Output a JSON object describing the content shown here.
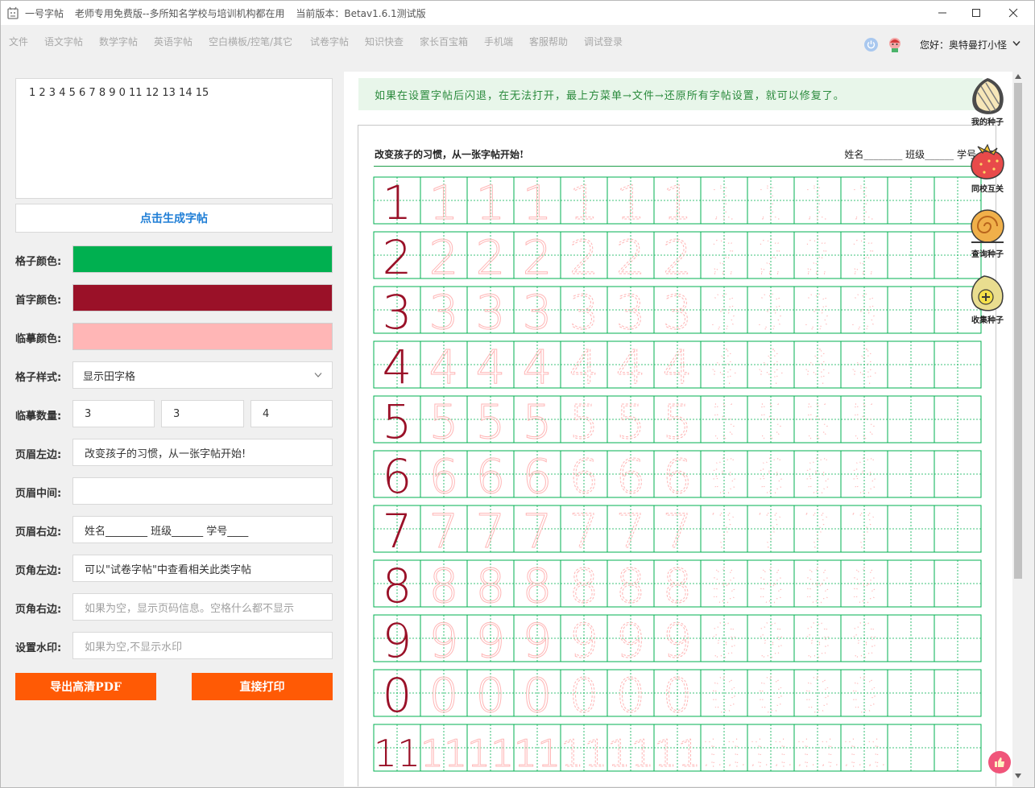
{
  "window": {
    "app_name": "一号字帖",
    "subtitle": "老师专用免费版--多所知名学校与培训机构都在用",
    "version": "当前版本：Betav1.6.1测试版"
  },
  "menu": [
    {
      "label": "文件"
    },
    {
      "label": "语文字帖"
    },
    {
      "label": "数学字帖"
    },
    {
      "label": "英语字帖"
    },
    {
      "label": "空白横板/控笔/其它"
    },
    {
      "label": "试卷字帖"
    },
    {
      "label": "知识快查"
    },
    {
      "label": "家长百宝箱"
    },
    {
      "label": "手机端"
    },
    {
      "label": "客服帮助"
    },
    {
      "label": "调试登录"
    }
  ],
  "user": {
    "greeting": "您好：奥特曼打小怪"
  },
  "form": {
    "content": "1 2 3 4 5 6 7 8 9 0 11 12 13 14 15",
    "generate_label": "点击生成字帖",
    "grid_color_label": "格子颜色:",
    "grid_color": "#00b050",
    "first_color_label": "首字颜色:",
    "first_color": "#9a1128",
    "trace_color_label": "临摹颜色:",
    "trace_color": "#ffb6b6",
    "grid_style_label": "格子样式:",
    "grid_style_value": "显示田字格",
    "trace_count_label": "临摹数量:",
    "trace_counts": [
      "3",
      "3",
      "4"
    ],
    "header_left_label": "页眉左边:",
    "header_left_value": "改变孩子的习惯，从一张字帖开始!",
    "header_middle_label": "页眉中间:",
    "header_middle_value": "",
    "header_right_label": "页眉右边:",
    "header_right_value": "姓名________ 班级______ 学号____",
    "footer_left_label": "页角左边:",
    "footer_left_value": "可以\"试卷字帖\"中查看相关此类字帖",
    "footer_right_label": "页角右边:",
    "footer_right_placeholder": "如果为空，显示页码信息。空格什么都不显示",
    "watermark_label": "设置水印:",
    "watermark_placeholder": "如果为空,不显示水印",
    "export_pdf_label": "导出高清PDF",
    "print_label": "直接打印"
  },
  "notice": "如果在设置字帖后闪退，在无法打开，最上方菜单→文件→还原所有字帖设置，就可以修复了。",
  "preview": {
    "header_left": "改变孩子的习惯，从一张字帖开始!",
    "header_right": "姓名________ 班级______ 学号____",
    "rows": [
      "1",
      "2",
      "3",
      "4",
      "5",
      "6",
      "7",
      "8",
      "9",
      "0",
      "11"
    ]
  },
  "side_panel": [
    {
      "label": "我的种子",
      "icon": "seed-icon"
    },
    {
      "label": "同校互关",
      "icon": "strawberry-icon"
    },
    {
      "label": "查询种子",
      "icon": "snail-icon"
    },
    {
      "label": "收集种子",
      "icon": "collect-seed-icon"
    }
  ]
}
